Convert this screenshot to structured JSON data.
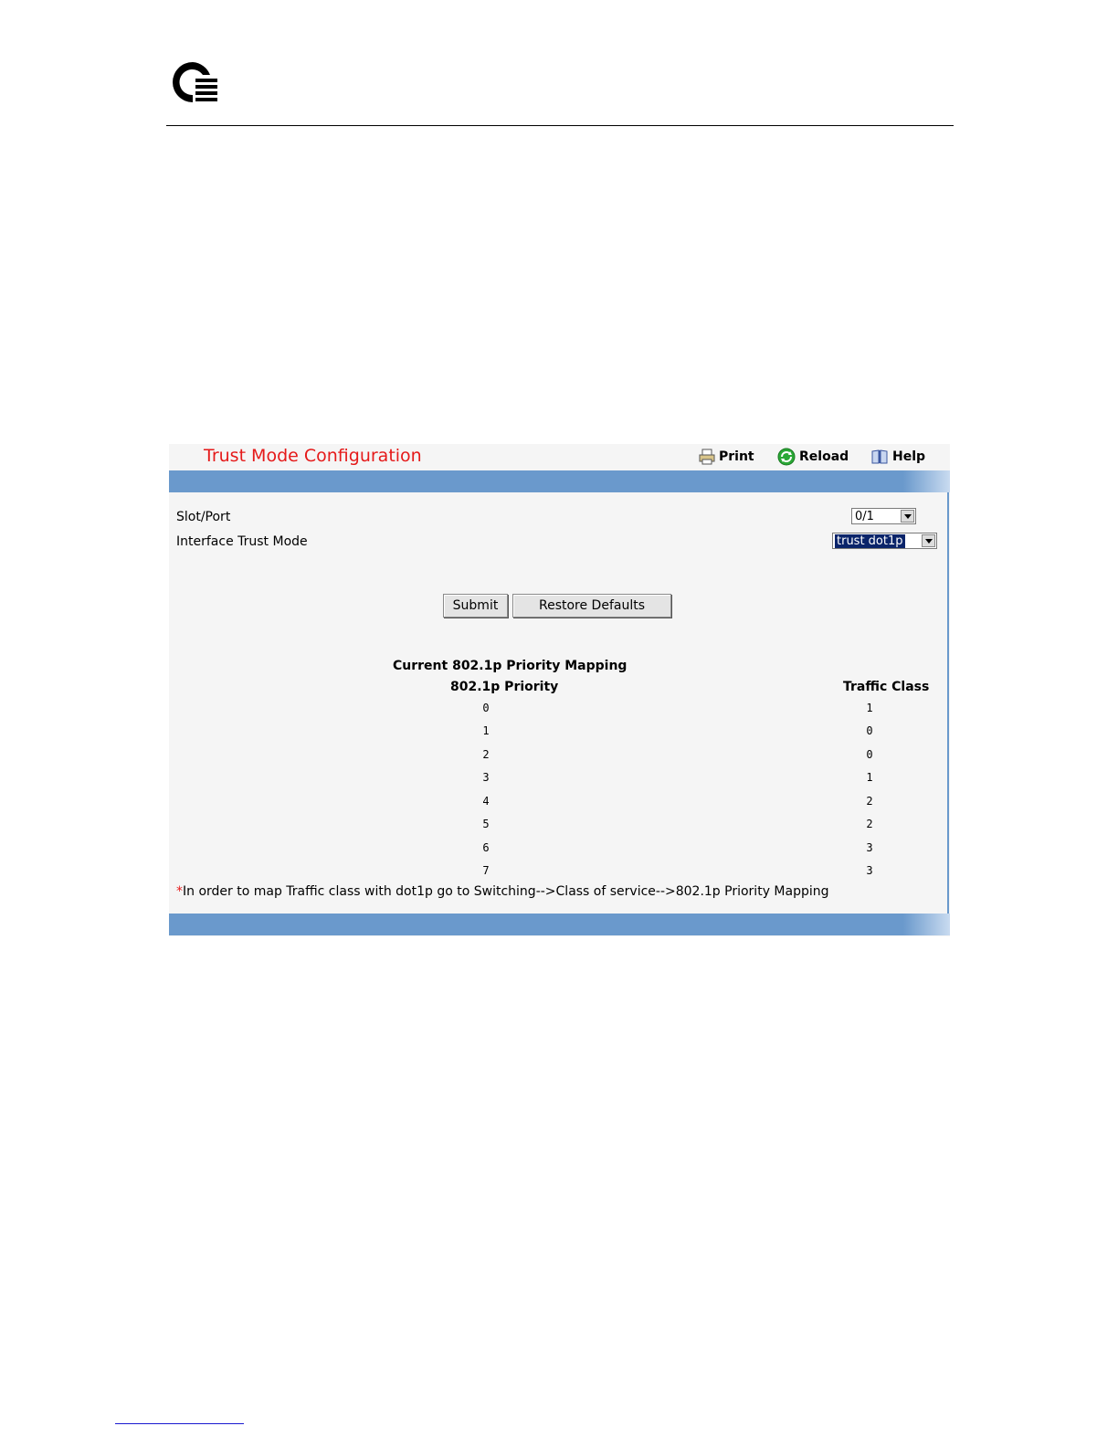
{
  "panel": {
    "title": "Trust Mode Configuration",
    "toolbar": {
      "print": "Print",
      "reload": "Reload",
      "help": "Help"
    }
  },
  "form": {
    "slot_port_label": "Slot/Port",
    "slot_port_value": "0/1",
    "trust_mode_label": "Interface Trust Mode",
    "trust_mode_value": "trust dot1p"
  },
  "buttons": {
    "submit": "Submit",
    "restore": "Restore Defaults"
  },
  "mapping": {
    "title": "Current 802.1p Priority Mapping",
    "col_priority": "802.1p Priority",
    "col_class": "Traffic Class",
    "rows": [
      {
        "priority": "0",
        "class": "1"
      },
      {
        "priority": "1",
        "class": "0"
      },
      {
        "priority": "2",
        "class": "0"
      },
      {
        "priority": "3",
        "class": "1"
      },
      {
        "priority": "4",
        "class": "2"
      },
      {
        "priority": "5",
        "class": "2"
      },
      {
        "priority": "6",
        "class": "3"
      },
      {
        "priority": "7",
        "class": "3"
      }
    ]
  },
  "note": {
    "star": "*",
    "text": "In order to map Traffic class with dot1p go to Switching-->Class of service-->802.1p Priority Mapping"
  },
  "colors": {
    "title_red": "#e51a1a",
    "band_blue": "#6a99cc",
    "panel_bg": "#f5f5f5"
  }
}
